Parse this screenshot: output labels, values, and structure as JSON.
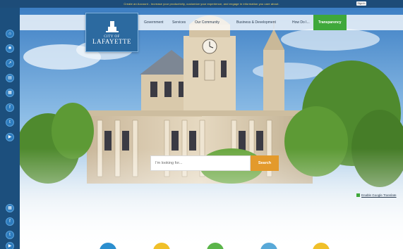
{
  "topbar": {
    "notice": "Create an Account - Increase your productivity, customize your experience, and engage in information you care about.",
    "sign_in": "Sign In"
  },
  "logo": {
    "city": "CITY OF",
    "name": "LAFAYETTE"
  },
  "nav": {
    "items": [
      "Government",
      "Services",
      "Our Community",
      "Business & Development",
      "How Do I...",
      "Transparency"
    ]
  },
  "search": {
    "placeholder": "I'm looking for...",
    "button_label": "Search"
  },
  "translate": {
    "label": "Enable Google Translate"
  },
  "rail": {
    "top_icons": [
      "home-icon",
      "gear-icon",
      "share-icon",
      "news-icon",
      "calendar-icon",
      "facebook-icon",
      "twitter-icon",
      "youtube-icon"
    ],
    "bottom_icons": [
      "calendar-icon",
      "facebook-icon",
      "twitter-icon",
      "youtube-icon"
    ]
  },
  "quick_links": {
    "colors": [
      "#2c8fcf",
      "#f0c02a",
      "#5bb54a",
      "#59a9d8",
      "#f0c02a"
    ]
  },
  "colors": {
    "accent_blue": "#1c4f7d",
    "transparency_green": "#3fa83a",
    "search_orange": "#e39a2c"
  }
}
